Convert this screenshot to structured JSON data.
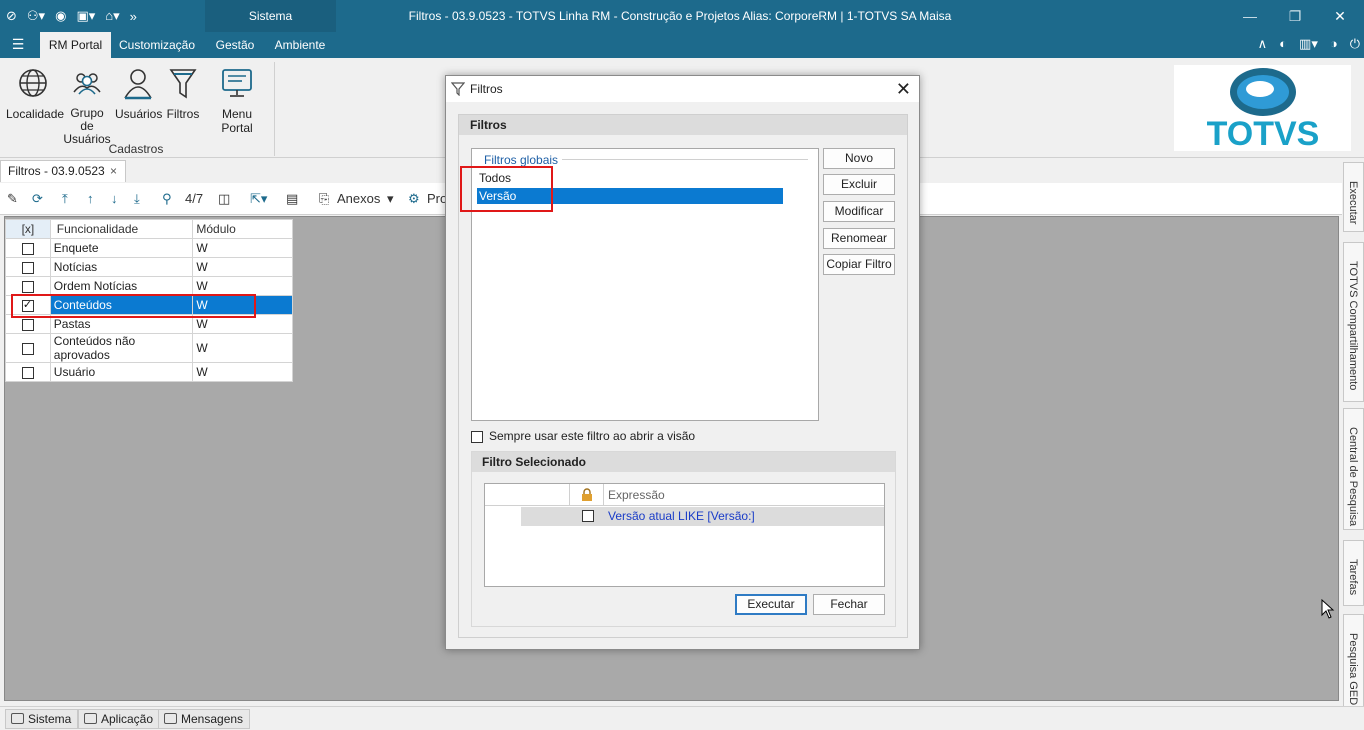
{
  "titlebar": {
    "sistema_tab": "Sistema",
    "title": "Filtros - 03.9.0523 - TOTVS Linha RM - Construção e Projetos  Alias: CorporeRM | 1-TOTVS SA Maisa"
  },
  "menu": {
    "items": [
      "RM Portal",
      "Customização",
      "Gestão",
      "Ambiente"
    ],
    "active": "RM Portal"
  },
  "ribbon": {
    "buttons": [
      {
        "label": "Localidade",
        "icon": "globe-icon"
      },
      {
        "label": "Grupo de Usuários",
        "icon": "user-group-icon"
      },
      {
        "label": "Usuários",
        "icon": "user-icon"
      },
      {
        "label": "Filtros",
        "icon": "funnel-icon"
      },
      {
        "label": "Menu Portal",
        "icon": "monitor-icon"
      }
    ],
    "group_label": "Cadastros",
    "logo_text": "TOTVS"
  },
  "doc_tab": {
    "label": "Filtros - 03.9.0523",
    "close": "×"
  },
  "toolbar": {
    "record_counter": "4/7",
    "anexos_label": "Anexos",
    "pro_label": "Pro"
  },
  "grid": {
    "headers": [
      "[x]",
      "Funcionalidade",
      "Módulo"
    ],
    "rows": [
      {
        "checked": false,
        "funcionalidade": "Enquete",
        "modulo": "W"
      },
      {
        "checked": false,
        "funcionalidade": "Notícias",
        "modulo": "W"
      },
      {
        "checked": false,
        "funcionalidade": "Ordem Notícias",
        "modulo": "W"
      },
      {
        "checked": true,
        "funcionalidade": "Conteúdos",
        "modulo": "W",
        "selected": true
      },
      {
        "checked": false,
        "funcionalidade": "Pastas",
        "modulo": "W"
      },
      {
        "checked": false,
        "funcionalidade": "Conteúdos não aprovados",
        "modulo": "W"
      },
      {
        "checked": false,
        "funcionalidade": "Usuário",
        "modulo": "W"
      }
    ]
  },
  "side_tabs": [
    "Executar",
    "TOTVS Compartilhamento",
    "Central de Pesquisa",
    "Tarefas",
    "Pesquisa GED"
  ],
  "statusbar": [
    "Sistema",
    "Aplicação",
    "Mensagens"
  ],
  "dialog": {
    "title": "Filtros",
    "section_filtros": "Filtros",
    "legend": "Filtros globais",
    "filters": [
      "Todos",
      "Versão"
    ],
    "selected_filter": "Versão",
    "buttons": [
      "Novo",
      "Excluir",
      "Modificar",
      "Renomear",
      "Copiar Filtro"
    ],
    "checkbox_label": "Sempre usar este filtro ao abrir a visão",
    "section_selected": "Filtro Selecionado",
    "expr_header": "Expressão",
    "expression": "Versão atual LIKE [Versão:]",
    "executar": "Executar",
    "fechar": "Fechar"
  },
  "colors": {
    "brand_blue": "#1d6a8c",
    "selection_blue": "#0b7ad1",
    "highlight_red": "#e01818",
    "workspace_grey": "#a9a9a9"
  }
}
